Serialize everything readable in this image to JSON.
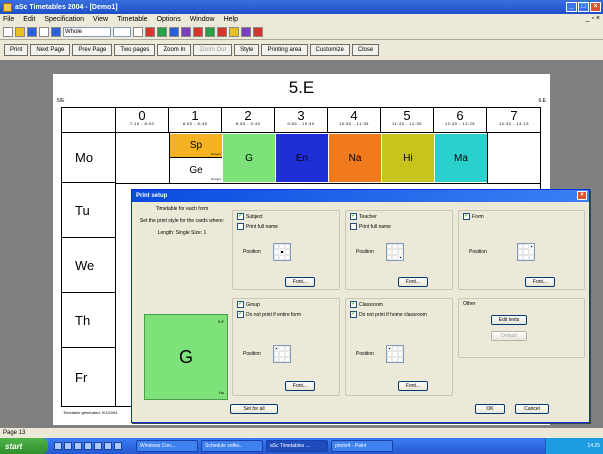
{
  "window": {
    "title": "aSc Timetables 2004 - [Demo1]",
    "minimize": "_",
    "maximize": "□",
    "close": "×"
  },
  "menu": {
    "items": [
      "File",
      "Edit",
      "Specification",
      "View",
      "Timetable",
      "Options",
      "Window",
      "Help"
    ],
    "mdi_controls": "_ ▫ ×"
  },
  "toolbar": {
    "combo_value": "Whole",
    "combo2_value": ""
  },
  "preview_toolbar": {
    "buttons": [
      "Print",
      "Next Page",
      "Prev Page",
      "Two pages",
      "Zoom In",
      "Zoom Out",
      "Style",
      "Printing area",
      "Customize",
      "Close"
    ]
  },
  "page": {
    "title": "5.E",
    "left_code": "5/E",
    "right_code": "6.E",
    "periods": [
      {
        "num": "0",
        "time": "7:15 - 8:00"
      },
      {
        "num": "1",
        "time": "8:00 - 8:45"
      },
      {
        "num": "2",
        "time": "8:55 - 9:40"
      },
      {
        "num": "3",
        "time": "9:55 - 10:40"
      },
      {
        "num": "4",
        "time": "10:50 - 11:35"
      },
      {
        "num": "5",
        "time": "11:45 - 12:30"
      },
      {
        "num": "6",
        "time": "12:40 - 13:25"
      },
      {
        "num": "7",
        "time": "13:30 - 14:15"
      }
    ],
    "days": [
      "Mo",
      "Tu",
      "We",
      "Th",
      "Fr"
    ],
    "monday_lessons": [
      {
        "top": "Sp",
        "top_tag": "Group1",
        "bottom": "Ge",
        "bottom_tag": "Group1",
        "top_color": "#f5b323",
        "bottom_color": "#ffffff"
      },
      {
        "label": "G",
        "color": "#7ee27a"
      },
      {
        "label": "En",
        "color": "#1e2fd6"
      },
      {
        "label": "Na",
        "color": "#f07a1c"
      },
      {
        "label": "Hi",
        "color": "#c8c41c"
      },
      {
        "label": "Ma",
        "color": "#2ad1cc"
      }
    ],
    "footer": "Timetable generated: 9/1/2004"
  },
  "dialog": {
    "title": "Print setup",
    "close": "×",
    "left_text_1": "Timetable for each form",
    "left_text_2": "Set the print style for the cards where:",
    "left_text_3": "Length: Single Size: 1",
    "preview": {
      "label": "G",
      "top_right": "5.E",
      "bottom_right": "Hu",
      "color": "#7ee27a"
    },
    "subject": {
      "check": "Subject",
      "print_full": "Print full name",
      "position": "Position",
      "font": "Font..."
    },
    "teacher": {
      "check": "Teacher",
      "print_full": "Print full name",
      "position": "Position",
      "font": "Font..."
    },
    "form": {
      "check": "Form",
      "position": "Position",
      "font": "Font..."
    },
    "group": {
      "check": "Group",
      "dont_print": "Do not print if entire form",
      "position": "Position",
      "font": "Font..."
    },
    "classroom": {
      "check": "Classroom",
      "dont_print": "Do not print if home classroom",
      "position": "Position",
      "font": "Font..."
    },
    "other": {
      "label": "Other",
      "edit_texts": "Edit texts",
      "default": "Default"
    },
    "set_for_all": "Set for all",
    "ok": "OK",
    "cancel": "Cancel"
  },
  "status": {
    "text": "Page 13"
  },
  "taskbar": {
    "start": "start",
    "tasks": [
      "Windows Con...",
      "Schedule softw...",
      "aSc Timetables ...",
      "photo4 - Paint"
    ],
    "tray_time": "14:25"
  }
}
